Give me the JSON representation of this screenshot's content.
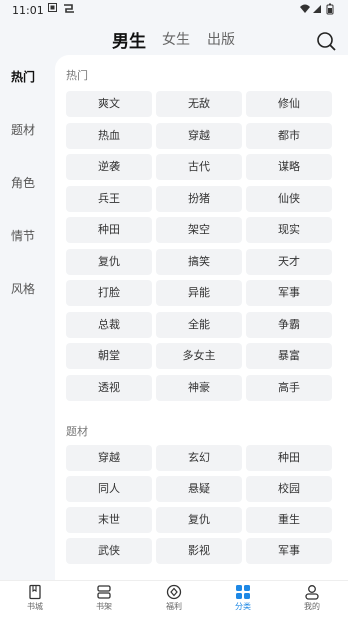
{
  "status_bar": {
    "time": "11:01",
    "icons": [
      "notification-icon",
      "app-icon"
    ],
    "right": [
      "wifi-icon",
      "signal-icon",
      "battery-icon"
    ]
  },
  "header": {
    "tabs": [
      {
        "label": "男生",
        "active": true
      },
      {
        "label": "女生",
        "active": false
      },
      {
        "label": "出版",
        "active": false
      }
    ],
    "search_icon": "search-icon"
  },
  "sidebar": {
    "items": [
      {
        "label": "热门",
        "active": true
      },
      {
        "label": "题材",
        "active": false
      },
      {
        "label": "角色",
        "active": false
      },
      {
        "label": "情节",
        "active": false
      },
      {
        "label": "风格",
        "active": false
      }
    ]
  },
  "sections": [
    {
      "title": "热门",
      "tags": [
        "爽文",
        "无敌",
        "修仙",
        "热血",
        "穿越",
        "都市",
        "逆袭",
        "古代",
        "谋略",
        "兵王",
        "扮猪",
        "仙侠",
        "种田",
        "架空",
        "现实",
        "复仇",
        "搞笑",
        "天才",
        "打脸",
        "异能",
        "军事",
        "总裁",
        "全能",
        "争霸",
        "朝堂",
        "多女主",
        "暴富",
        "透视",
        "神豪",
        "高手"
      ]
    },
    {
      "title": "题材",
      "tags": [
        "穿越",
        "玄幻",
        "种田",
        "同人",
        "悬疑",
        "校园",
        "末世",
        "复仇",
        "重生",
        "武侠",
        "影视",
        "军事"
      ]
    }
  ],
  "bottom_nav": {
    "items": [
      {
        "label": "书城",
        "icon": "book-icon",
        "active": false
      },
      {
        "label": "书架",
        "icon": "bookshelf-icon",
        "active": false
      },
      {
        "label": "福利",
        "icon": "gift-icon",
        "active": false
      },
      {
        "label": "分类",
        "icon": "category-icon",
        "active": true
      },
      {
        "label": "我的",
        "icon": "profile-icon",
        "active": false
      }
    ],
    "accent_color": "#1e88e5"
  }
}
